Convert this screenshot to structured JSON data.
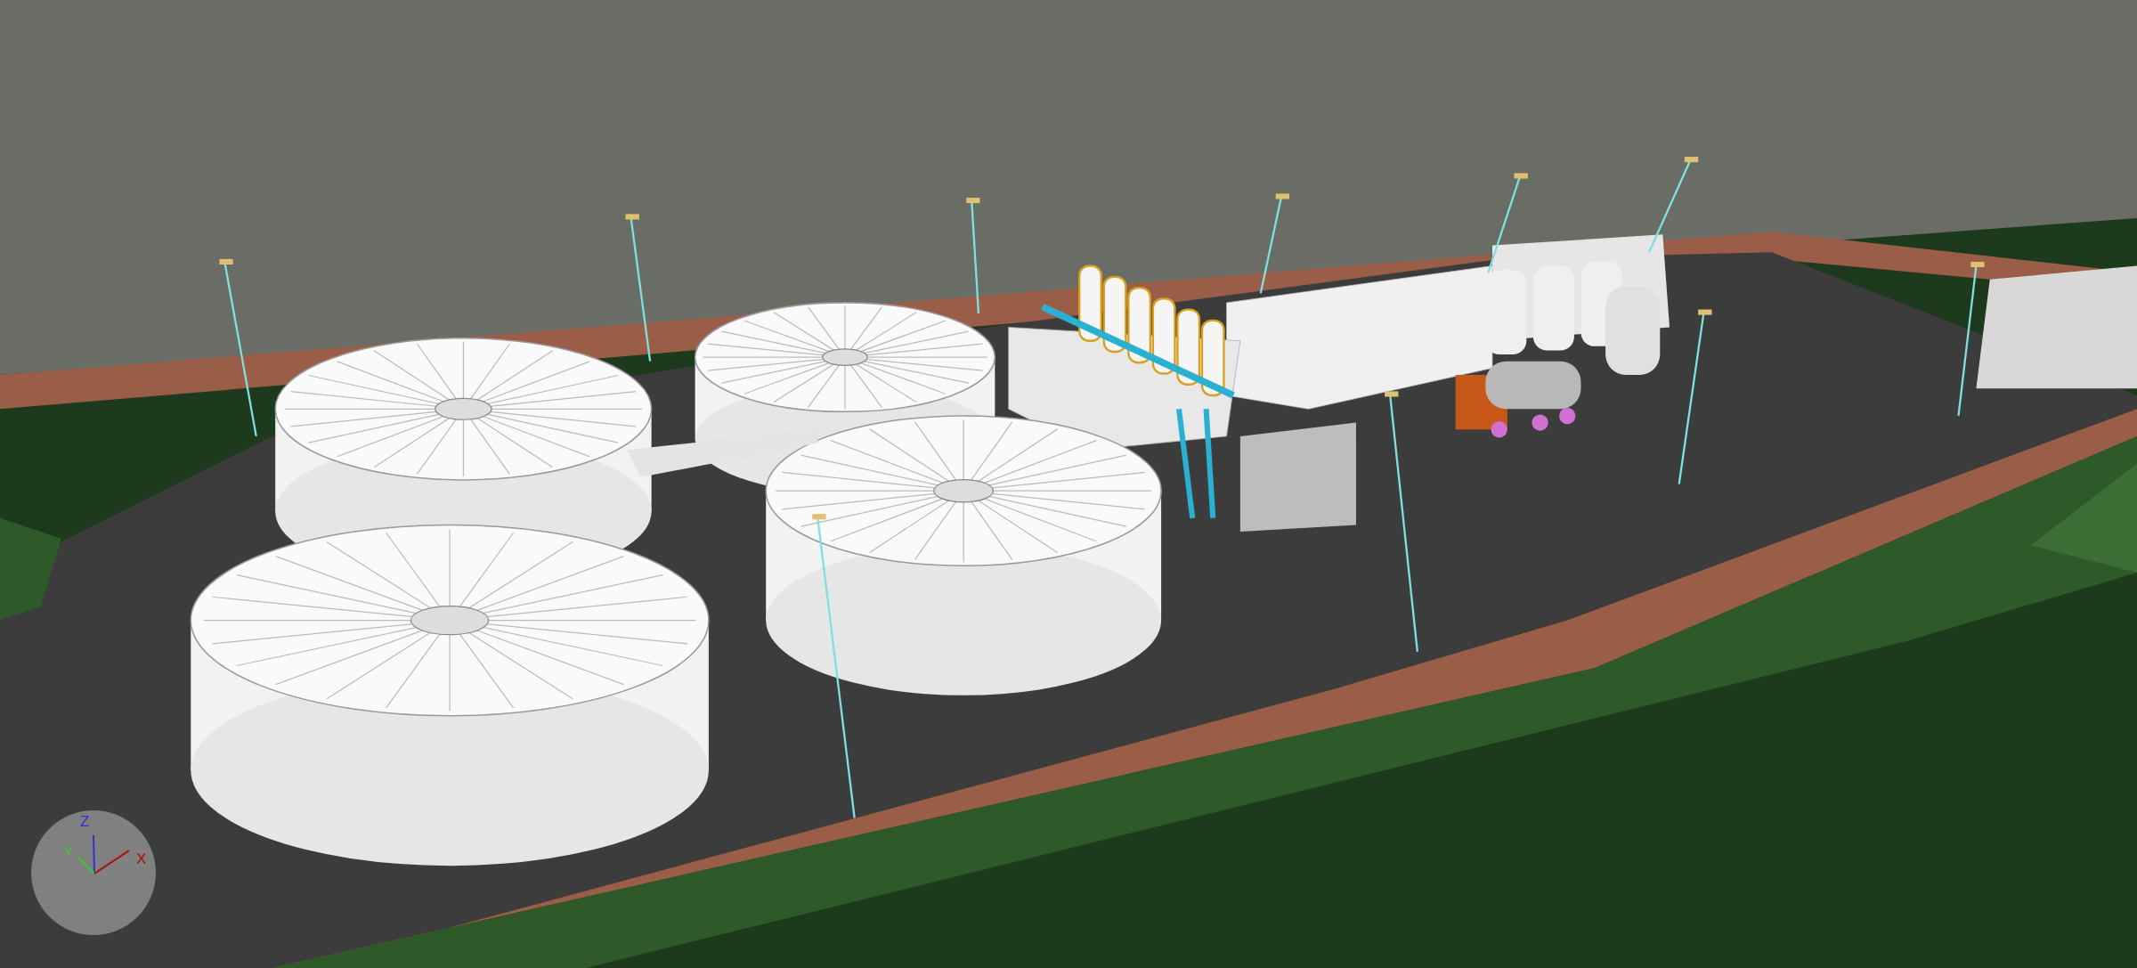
{
  "viewport": {
    "axis_gizmo": {
      "axes": [
        {
          "label": "Z",
          "color": "#3333cc"
        },
        {
          "label": "Y",
          "color": "#33cc33"
        },
        {
          "label": "X",
          "color": "#a80c0c"
        }
      ]
    }
  }
}
